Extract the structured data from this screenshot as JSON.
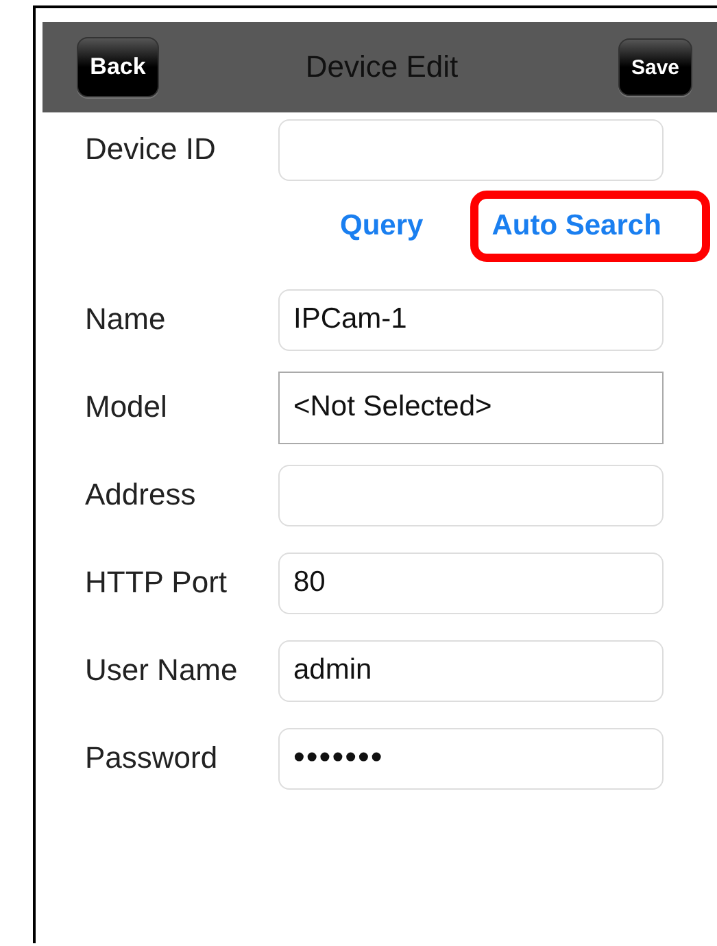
{
  "nav_bar": {
    "back_button": "Back",
    "title": "Device Edit",
    "save_button": "Save"
  },
  "device_id": {
    "label": "Device ID"
  },
  "actions": [
    {
      "label": "Query",
      "highlighted": false
    },
    {
      "label": "Auto Search",
      "highlighted": true
    }
  ],
  "fields": [
    {
      "label": "Name",
      "kind": "text",
      "value": "IPCam-1"
    },
    {
      "label": "Model",
      "kind": "select",
      "value": "<Not Selected>"
    },
    {
      "label": "Address",
      "kind": "text"
    },
    {
      "label": "HTTP Port",
      "kind": "text",
      "value": "80"
    },
    {
      "label": "User Name",
      "kind": "text",
      "value": "admin"
    },
    {
      "label": "Password",
      "kind": "password",
      "value": "•••••••"
    }
  ]
}
